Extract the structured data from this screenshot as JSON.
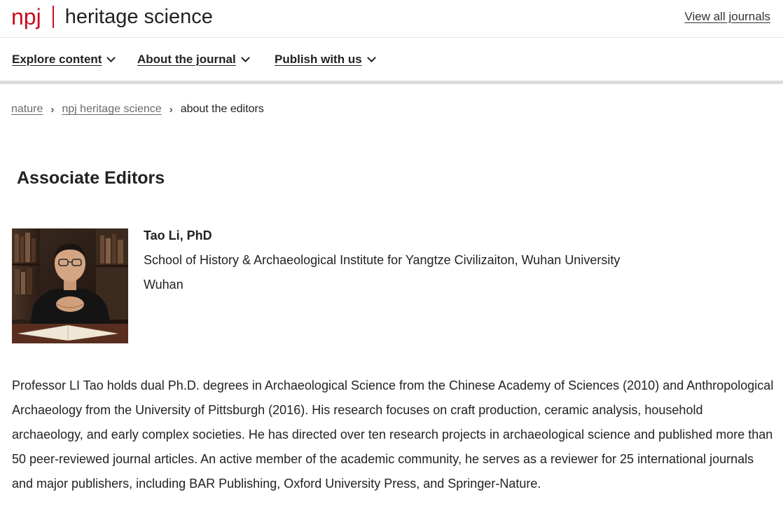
{
  "header": {
    "brand_prefix": "npj",
    "brand_title": "heritage science",
    "view_all_label": "View all journals"
  },
  "nav": {
    "items": [
      {
        "label": "Explore content"
      },
      {
        "label": "About the journal"
      },
      {
        "label": "Publish with us"
      }
    ]
  },
  "breadcrumb": {
    "items": [
      {
        "label": "nature"
      },
      {
        "label": "npj heritage science"
      }
    ],
    "separator": "›",
    "current": "about the editors"
  },
  "section": {
    "heading": "Associate Editors"
  },
  "editor": {
    "name": "Tao Li, PhD",
    "affiliation": "School of History & Archaeological Institute for Yangtze Civilizaiton, Wuhan University",
    "city": "Wuhan",
    "bio": "Professor LI Tao holds dual Ph.D. degrees in Archaeological Science from the Chinese Academy of Sciences (2010) and Anthropological Archaeology from the University of Pittsburgh (2016). His research focuses on craft production, ceramic analysis, household archaeology, and early complex societies. He has directed over ten research projects in archaeological science and published more than 50 peer-reviewed journal articles. An active member of the academic community, he serves as a reviewer for 25 international journals and major publishers, including BAR Publishing, Oxford University Press, and Springer-Nature."
  },
  "colors": {
    "brand_red": "#c80d1f",
    "text": "#222222",
    "muted_link": "#6b6b6b",
    "rule": "#dcdcdc"
  }
}
